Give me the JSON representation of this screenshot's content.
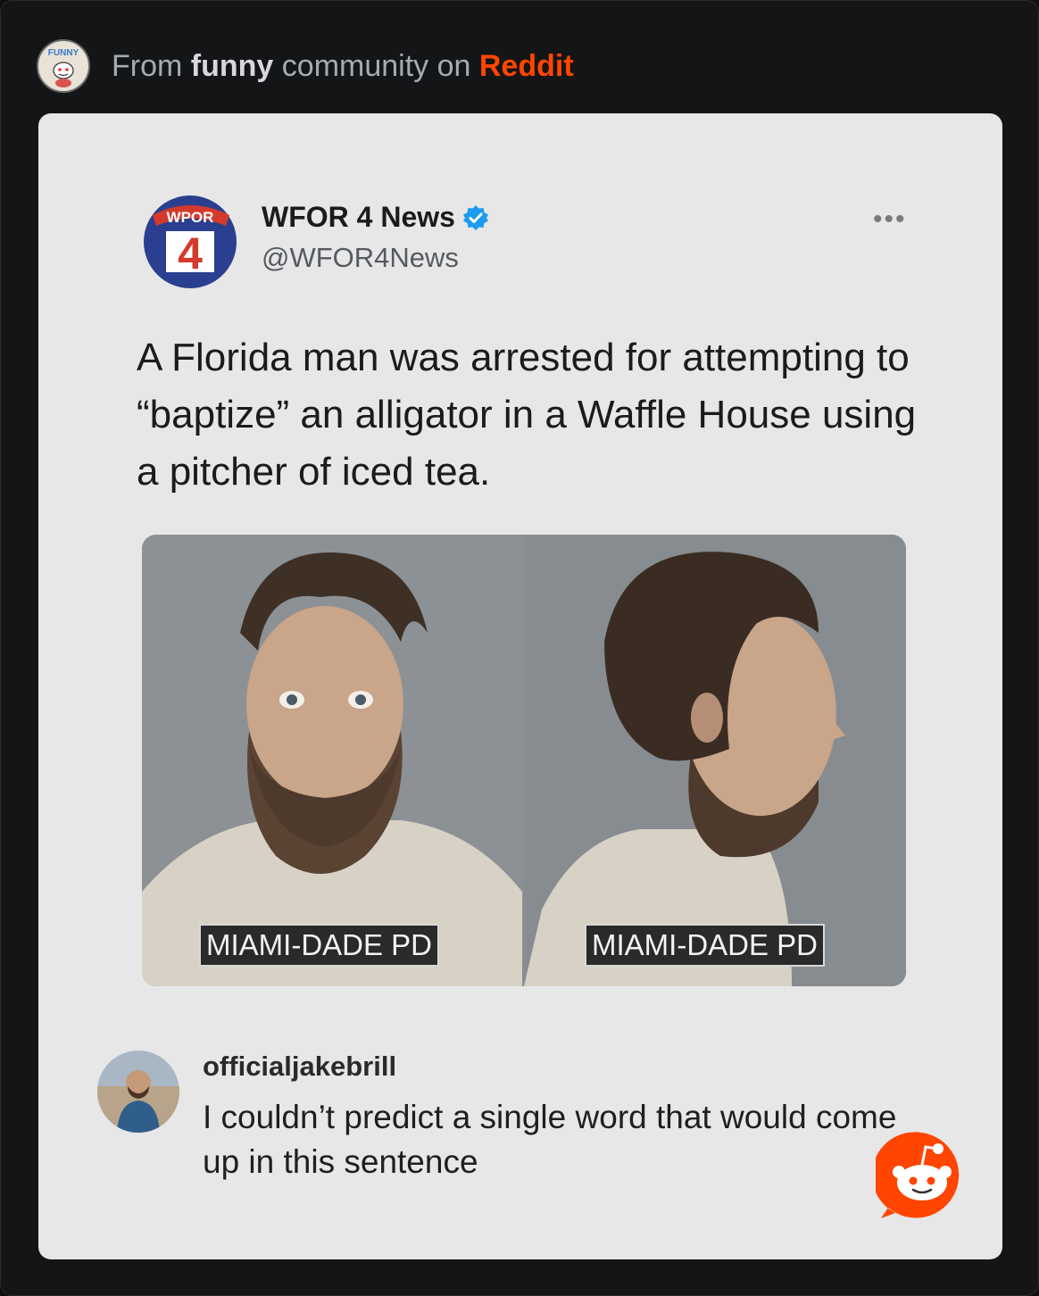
{
  "header": {
    "prefix": "From",
    "community": "funny",
    "middle": "community on",
    "platform": "Reddit",
    "community_icon": "funny-subreddit-icon"
  },
  "tweet": {
    "logo_text": "WPOR",
    "logo_number": "4",
    "author_name": "WFOR 4 News",
    "verified_icon": "verified-badge-icon",
    "handle": "@WFOR4News",
    "more": "•••",
    "text": "A Florida man was arrested for attempting to “baptize” an alligator in a Waffle House using a pitcher of iced tea.",
    "photo_captions": [
      "MIAMI-DADE PD",
      "MIAMI-DADE PD"
    ]
  },
  "comment": {
    "username": "officialjakebrill",
    "text": "I couldn’t predict a single word that would come up in this sentence"
  },
  "colors": {
    "reddit_orange": "#ff4500",
    "card_bg": "#e7e7e8",
    "page_bg": "#141516",
    "logo_blue": "#2a3f8f",
    "logo_red": "#d33a2c"
  }
}
